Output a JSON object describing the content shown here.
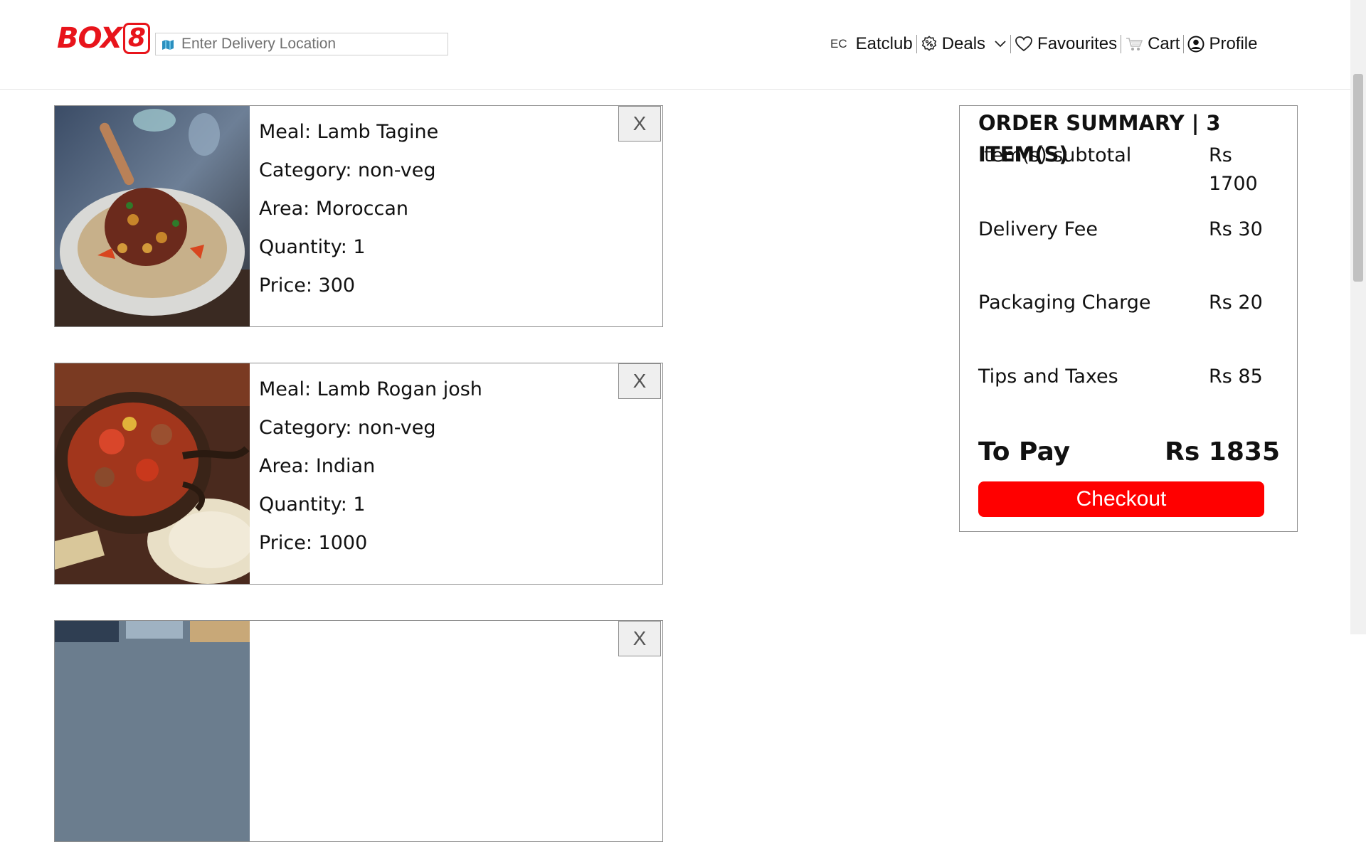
{
  "header": {
    "logo_text": "BOX",
    "logo_eight": "8",
    "brand_color": "#e8141b",
    "search": {
      "placeholder": "Enter Delivery Location",
      "value": ""
    },
    "nav": {
      "eatclub_prefix": "EC",
      "eatclub_label": "Eatclub",
      "deals_label": "Deals",
      "favourites_label": "Favourites",
      "cart_label": "Cart",
      "profile_label": "Profile"
    }
  },
  "cart_items": [
    {
      "meal": "Meal: Lamb Tagine",
      "category": "Category: non-veg",
      "area": "Area: Moroccan",
      "quantity": "Quantity: 1",
      "price": "Price: 300",
      "remove_label": "X"
    },
    {
      "meal": "Meal: Lamb Rogan josh",
      "category": "Category: non-veg",
      "area": "Area: Indian",
      "quantity": "Quantity: 1",
      "price": "Price: 1000",
      "remove_label": "X"
    },
    {
      "meal": "",
      "category": "",
      "area": "",
      "quantity": "",
      "price": "",
      "remove_label": "X"
    }
  ],
  "summary": {
    "title": "ORDER SUMMARY | 3 ITEM(S)",
    "rows": [
      {
        "label": "Item(s) subtotal",
        "value": "Rs 1700"
      },
      {
        "label": "Delivery Fee",
        "value": "Rs 30"
      },
      {
        "label": "Packaging Charge",
        "value": "Rs 20"
      },
      {
        "label": "Tips and Taxes",
        "value": "Rs 85"
      }
    ],
    "total_label": "To Pay",
    "total_value": "Rs 1835",
    "checkout_label": "Checkout",
    "checkout_color": "#ff0000"
  }
}
